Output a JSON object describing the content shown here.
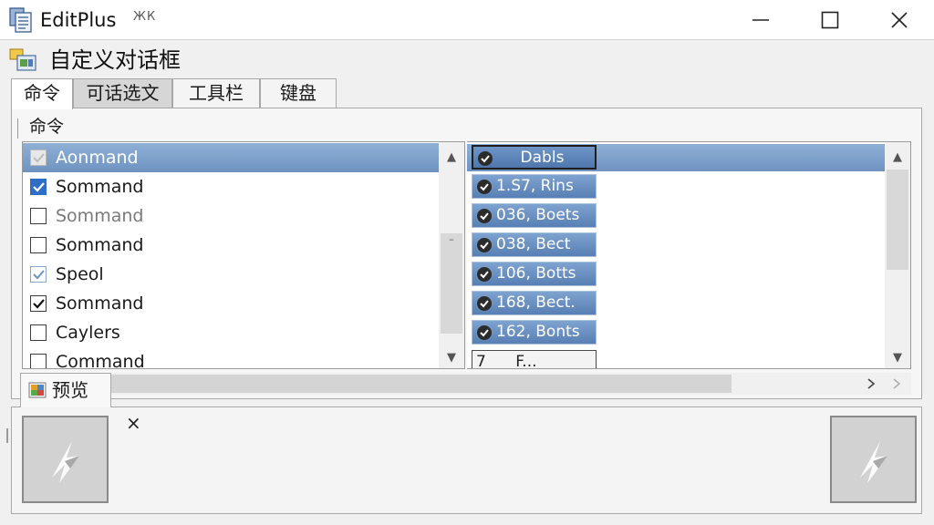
{
  "window": {
    "title": "EditPlus",
    "title_glyph": "ЖК",
    "minimize_icon": "minimize-icon",
    "maximize_icon": "maximize-icon",
    "close_icon": "close-icon"
  },
  "dialog": {
    "title": "自定义对话框"
  },
  "tabs": [
    {
      "label": "命令"
    },
    {
      "label": "可话选文"
    },
    {
      "label": "工具栏"
    },
    {
      "label": "键盘"
    }
  ],
  "group": {
    "label": "命令"
  },
  "commands": [
    {
      "label": "Aonmand",
      "check": "grey",
      "selected": true
    },
    {
      "label": "Sommand",
      "check": "blue"
    },
    {
      "label": "Sommand",
      "check": "empty",
      "dim": true
    },
    {
      "label": "Sommand",
      "check": "empty"
    },
    {
      "label": "Speol",
      "check": "light"
    },
    {
      "label": "Sommand",
      "check": "dark"
    },
    {
      "label": "Caylers",
      "check": "empty"
    },
    {
      "label": "Command",
      "check": "empty"
    }
  ],
  "keys": [
    {
      "label": "Dabls",
      "style": "head"
    },
    {
      "label": "1.S7, Rins",
      "style": "normal"
    },
    {
      "label": "036, Boets",
      "style": "normal"
    },
    {
      "label": "038, Bect",
      "style": "normal"
    },
    {
      "label": "106, Botts",
      "style": "normal"
    },
    {
      "label": "168, Bect.",
      "style": "normal"
    },
    {
      "label": "162, Bonts",
      "style": "normal"
    },
    {
      "label": "7      F...",
      "style": "plain"
    }
  ],
  "preview": {
    "label": "预览",
    "close_glyph": "×"
  },
  "colors": {
    "selection": "#7a9cc8",
    "checkbox_blue": "#2e6fc5"
  }
}
